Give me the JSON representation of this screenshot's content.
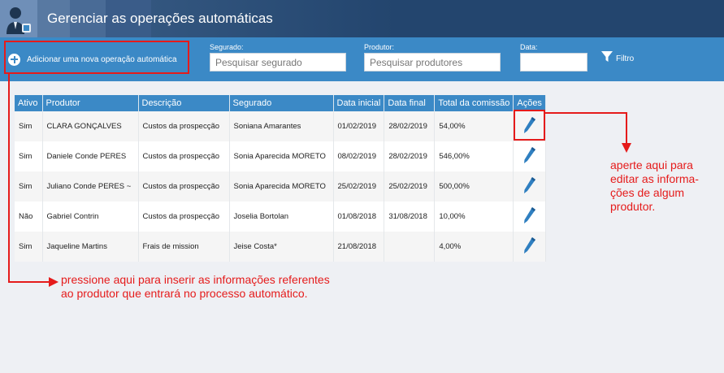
{
  "header": {
    "title": "Gerenciar as operações automáticas"
  },
  "toolbar": {
    "add_label": "Adicionar uma nova operação automática",
    "segurado_label": "Segurado:",
    "segurado_placeholder": "Pesquisar segurado",
    "produtor_label": "Produtor:",
    "produtor_placeholder": "Pesquisar produtores",
    "data_label": "Data:",
    "data_value": "",
    "filter_label": "Filtro"
  },
  "table": {
    "headers": [
      "Ativo",
      "Produtor",
      "Descrição",
      "Segurado",
      "Data inicial",
      "Data final",
      "Total da comissão",
      "Ações"
    ],
    "rows": [
      {
        "ativo": "Sim",
        "produtor": "CLARA GONÇALVES",
        "descricao": "Custos da prospecção",
        "segurado": "Soniana Amarantes",
        "data_inicial": "01/02/2019",
        "data_final": "28/02/2019",
        "comissao": "54,00%"
      },
      {
        "ativo": "Sim",
        "produtor": "Daniele Conde PERES",
        "descricao": "Custos da prospecção",
        "segurado": "Sonia Aparecida MORETO",
        "data_inicial": "08/02/2019",
        "data_final": "28/02/2019",
        "comissao": "546,00%"
      },
      {
        "ativo": "Sim",
        "produtor": "Juliano Conde PERES ~",
        "descricao": "Custos da prospecção",
        "segurado": "Sonia Aparecida MORETO",
        "data_inicial": "25/02/2019",
        "data_final": "25/02/2019",
        "comissao": "500,00%"
      },
      {
        "ativo": "Não",
        "produtor": "Gabriel Contrin",
        "descricao": "Custos da prospecção",
        "segurado": "Joselia Bortolan",
        "data_inicial": "01/08/2018",
        "data_final": "31/08/2018",
        "comissao": "10,00%"
      },
      {
        "ativo": "Sim",
        "produtor": "Jaqueline Martins",
        "descricao": "Frais de mission",
        "segurado": "Jeise Costa*",
        "data_inicial": "21/08/2018",
        "data_final": "",
        "comissao": "4,00%"
      }
    ]
  },
  "annotations": {
    "edit_note": [
      "aperte aqui para",
      "editar as informa-",
      "ções de algum",
      "produtor."
    ],
    "insert_note": [
      "pressione aqui para inserir as informações referentes",
      "ao produtor que entrará no processo automático."
    ]
  },
  "icons": {
    "logo": "user-avatar-icon",
    "add": "plus-circle-icon",
    "filter": "funnel-icon",
    "edit": "pen-icon"
  },
  "colors": {
    "header_bg": "#23456e",
    "toolbar_bg": "#3b89c6",
    "annotation_red": "#e51b1b",
    "pen_blue": "#2f7fc0"
  }
}
